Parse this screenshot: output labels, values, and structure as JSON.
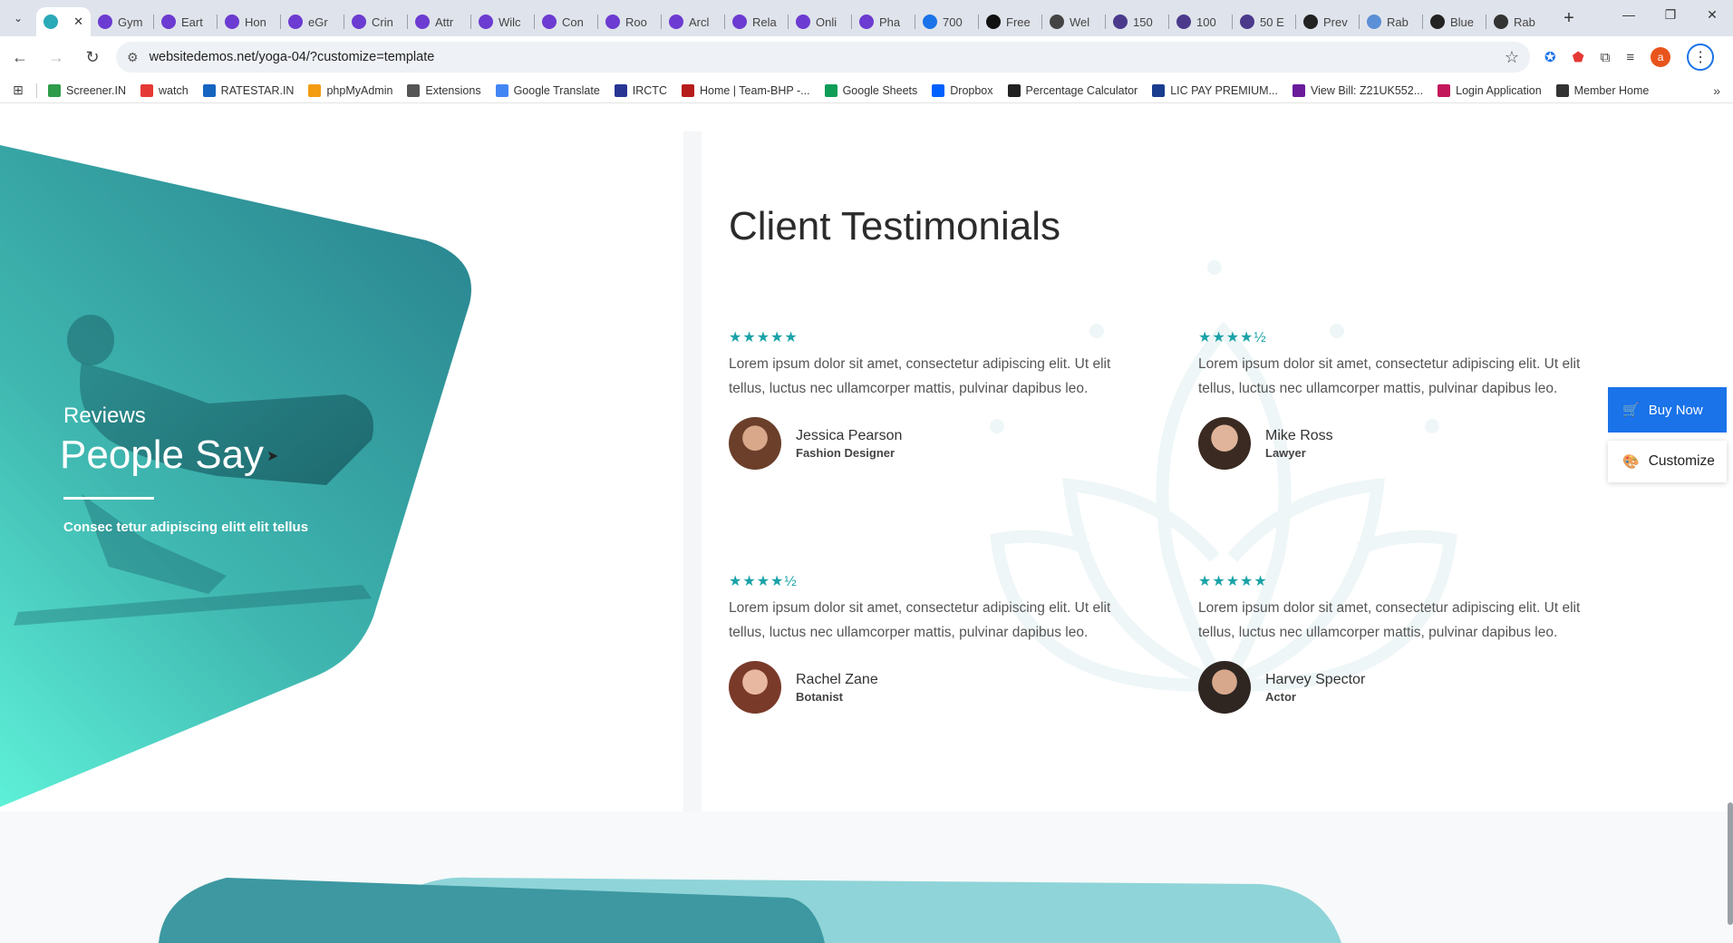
{
  "browser": {
    "tabs": [
      {
        "label": "",
        "active": true,
        "color": "#2aa9b7"
      },
      {
        "label": "Gym",
        "color": "#6c3bd1"
      },
      {
        "label": "Eart",
        "color": "#6c3bd1"
      },
      {
        "label": "Hon",
        "color": "#6c3bd1"
      },
      {
        "label": "eGr",
        "color": "#6c3bd1"
      },
      {
        "label": "Crin",
        "color": "#6c3bd1"
      },
      {
        "label": "Attr",
        "color": "#6c3bd1"
      },
      {
        "label": "Wilc",
        "color": "#6c3bd1"
      },
      {
        "label": "Con",
        "color": "#6c3bd1"
      },
      {
        "label": "Roo",
        "color": "#6c3bd1"
      },
      {
        "label": "Arcl",
        "color": "#6c3bd1"
      },
      {
        "label": "Rela",
        "color": "#6c3bd1"
      },
      {
        "label": "Onli",
        "color": "#6c3bd1"
      },
      {
        "label": "Pha",
        "color": "#6c3bd1"
      },
      {
        "label": "700",
        "color": "#1a73e8"
      },
      {
        "label": "Free",
        "color": "#111111"
      },
      {
        "label": "Wel",
        "color": "#444444"
      },
      {
        "label": "150",
        "color": "#4b3a8c"
      },
      {
        "label": "100",
        "color": "#4b3a8c"
      },
      {
        "label": "50 E",
        "color": "#4b3a8c"
      },
      {
        "label": "Prev",
        "color": "#222222"
      },
      {
        "label": "Rab",
        "color": "#5b8fd6"
      },
      {
        "label": "Blue",
        "color": "#222222"
      },
      {
        "label": "Rab",
        "color": "#333333"
      }
    ],
    "url": "websitedemos.net/yoga-04/?customize=template",
    "bookmarks": [
      {
        "label": "Screener.IN",
        "color": "#2e9c4a"
      },
      {
        "label": "watch",
        "color": "#e53935"
      },
      {
        "label": "RATESTAR.IN",
        "color": "#1565c0"
      },
      {
        "label": "phpMyAdmin",
        "color": "#f39c12"
      },
      {
        "label": "Extensions",
        "color": "#555555"
      },
      {
        "label": "Google Translate",
        "color": "#4285f4"
      },
      {
        "label": "IRCTC",
        "color": "#283593"
      },
      {
        "label": "Home | Team-BHP -...",
        "color": "#b71c1c"
      },
      {
        "label": "Google Sheets",
        "color": "#0f9d58"
      },
      {
        "label": "Dropbox",
        "color": "#0061ff"
      },
      {
        "label": "Percentage Calculator",
        "color": "#222222"
      },
      {
        "label": "LIC PAY PREMIUM...",
        "color": "#1a3d8f"
      },
      {
        "label": "View Bill: Z21UK552...",
        "color": "#6a1b9a"
      },
      {
        "label": "Login Application",
        "color": "#c2185b"
      },
      {
        "label": "Member Home",
        "color": "#333333"
      }
    ],
    "profile_initial": "a"
  },
  "hero": {
    "kicker": "Reviews",
    "title": "People Say",
    "subtitle": "Consec tetur adipiscing elitt elit tellus"
  },
  "section_title": "Client Testimonials",
  "testimonials": [
    {
      "stars": "★★★★★",
      "quote": "Lorem ipsum dolor sit amet, consectetur adipiscing elit. Ut elit tellus, luctus nec ullamcorper mattis, pulvinar dapibus leo.",
      "name": "Jessica Pearson",
      "role": "Fashion Designer"
    },
    {
      "stars": "★★★★½",
      "quote": "Lorem ipsum dolor sit amet, consectetur adipiscing elit. Ut elit tellus, luctus nec ullamcorper mattis, pulvinar dapibus leo.",
      "name": "Mike Ross",
      "role": "Lawyer"
    },
    {
      "stars": "★★★★½",
      "quote": "Lorem ipsum dolor sit amet, consectetur adipiscing elit. Ut elit tellus, luctus nec ullamcorper mattis, pulvinar dapibus leo.",
      "name": "Rachel Zane",
      "role": "Botanist"
    },
    {
      "stars": "★★★★★",
      "quote": "Lorem ipsum dolor sit amet, consectetur adipiscing elit. Ut elit tellus, luctus nec ullamcorper mattis, pulvinar dapibus leo.",
      "name": "Harvey Spector",
      "role": "Actor"
    }
  ],
  "side_buttons": {
    "buy": "Buy Now",
    "customize": "Customize"
  },
  "colors": {
    "accent": "#1aa3a8",
    "teal_dark": "#2c8a93",
    "teal_light": "#5ef0d8",
    "buy_button": "#1a73e8"
  }
}
